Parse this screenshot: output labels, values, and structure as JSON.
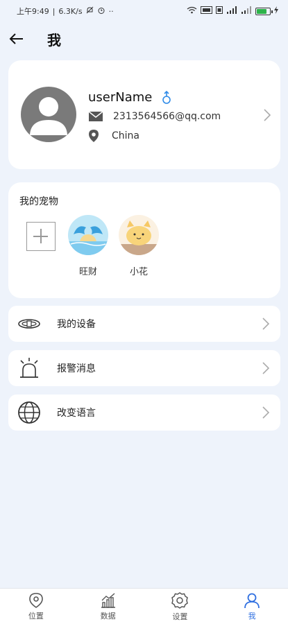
{
  "status_bar": {
    "time": "上午9:49",
    "speed": "6.3K/s",
    "battery_color": "#2db34a",
    "battery_level": 0.75
  },
  "header": {
    "title": "我",
    "back_icon": "arrow-left-icon"
  },
  "profile": {
    "username": "userName",
    "gender_icon": "male-icon",
    "email": "2313564566@qq.com",
    "location": "China"
  },
  "pets": {
    "title": "我的宠物",
    "items": [
      {
        "name": "旺财",
        "icon": "dolphin-avatar"
      },
      {
        "name": "小花",
        "icon": "cat-avatar"
      }
    ]
  },
  "menu": [
    {
      "label": "我的设备",
      "icon": "collar-icon"
    },
    {
      "label": "报警消息",
      "icon": "alarm-icon"
    },
    {
      "label": "改变语言",
      "icon": "globe-icon"
    }
  ],
  "bottom_nav": {
    "items": [
      {
        "label": "位置",
        "icon": "location-icon"
      },
      {
        "label": "数据",
        "icon": "chart-icon"
      },
      {
        "label": "设置",
        "icon": "gear-icon"
      },
      {
        "label": "我",
        "icon": "user-icon"
      }
    ],
    "active_color": "#2f6fe0"
  }
}
